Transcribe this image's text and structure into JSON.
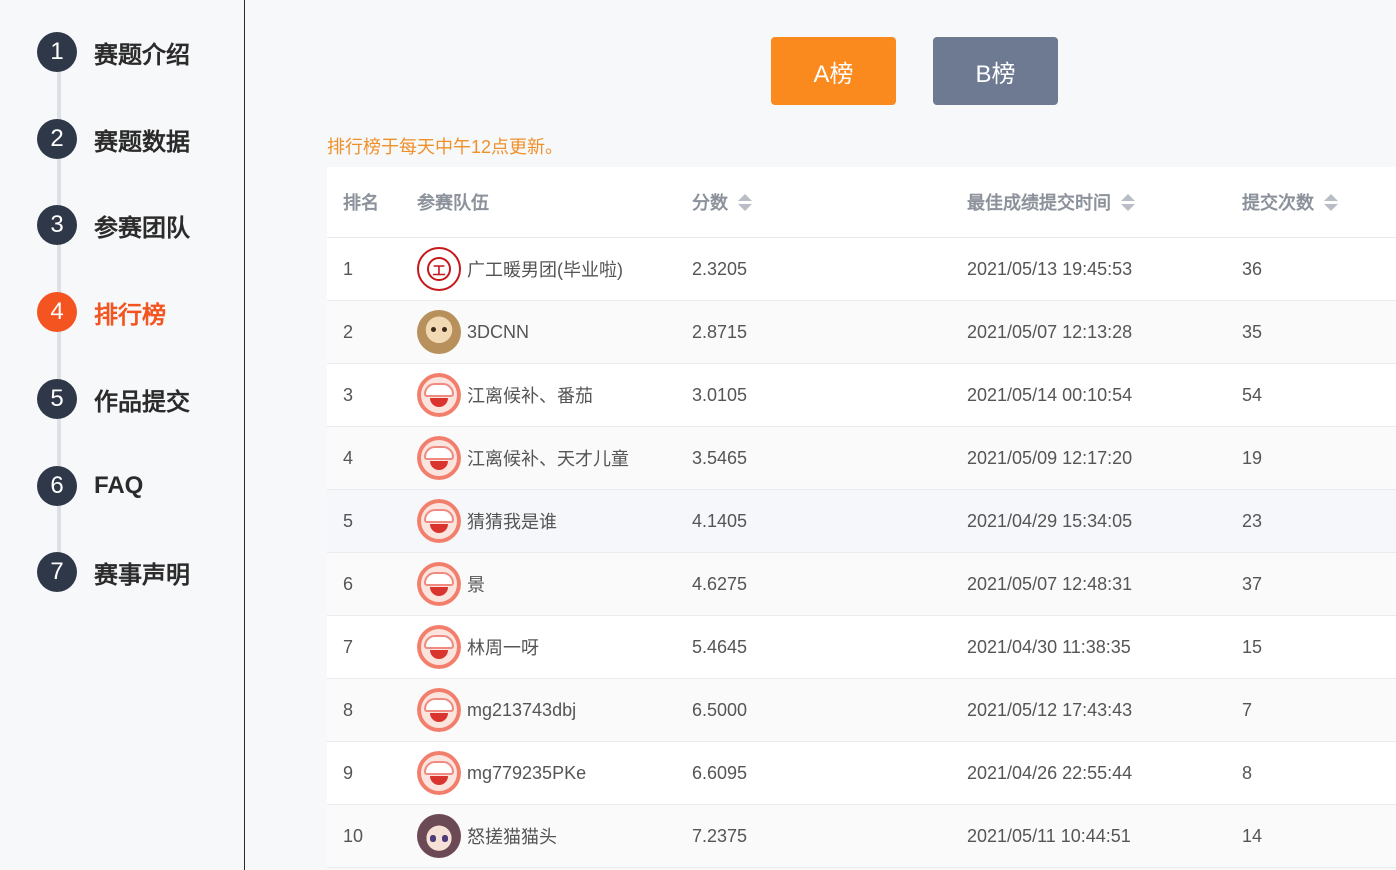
{
  "sidebar": {
    "steps": [
      {
        "num": "1",
        "label": "赛题介绍"
      },
      {
        "num": "2",
        "label": "赛题数据"
      },
      {
        "num": "3",
        "label": "参赛团队"
      },
      {
        "num": "4",
        "label": "排行榜",
        "active": true
      },
      {
        "num": "5",
        "label": "作品提交"
      },
      {
        "num": "6",
        "label": "FAQ"
      },
      {
        "num": "7",
        "label": "赛事声明"
      }
    ]
  },
  "board": {
    "a_label": "A榜",
    "b_label": "B榜",
    "a_color": "#fa891e",
    "b_color": "#6d7a92",
    "notice": "排行榜于每天中午12点更新。"
  },
  "table": {
    "headers": {
      "rank": "排名",
      "team": "参赛队伍",
      "score": "分数",
      "time": "最佳成绩提交时间",
      "count": "提交次数"
    },
    "rows": [
      {
        "rank": "1",
        "avatar": "school-logo-icon",
        "team": "广工暖男团(毕业啦)",
        "score": "2.3205",
        "time": "2021/05/13 19:45:53",
        "count": "36"
      },
      {
        "rank": "2",
        "avatar": "cat-avatar-icon",
        "team": "3DCNN",
        "score": "2.8715",
        "time": "2021/05/07 12:13:28",
        "count": "35"
      },
      {
        "rank": "3",
        "avatar": "default-avatar-icon",
        "team": "江离候补、番茄",
        "score": "3.0105",
        "time": "2021/05/14 00:10:54",
        "count": "54"
      },
      {
        "rank": "4",
        "avatar": "default-avatar-icon",
        "team": "江离候补、天才儿童",
        "score": "3.5465",
        "time": "2021/05/09 12:17:20",
        "count": "19"
      },
      {
        "rank": "5",
        "avatar": "default-avatar-icon",
        "team": "猜猜我是谁",
        "score": "4.1405",
        "time": "2021/04/29 15:34:05",
        "count": "23"
      },
      {
        "rank": "6",
        "avatar": "default-avatar-icon",
        "team": "景",
        "score": "4.6275",
        "time": "2021/05/07 12:48:31",
        "count": "37"
      },
      {
        "rank": "7",
        "avatar": "default-avatar-icon",
        "team": "林周一呀",
        "score": "5.4645",
        "time": "2021/04/30 11:38:35",
        "count": "15"
      },
      {
        "rank": "8",
        "avatar": "default-avatar-icon",
        "team": "mg213743dbj",
        "score": "6.5000",
        "time": "2021/05/12 17:43:43",
        "count": "7"
      },
      {
        "rank": "9",
        "avatar": "default-avatar-icon",
        "team": "mg779235PKe",
        "score": "6.6095",
        "time": "2021/04/26 22:55:44",
        "count": "8"
      },
      {
        "rank": "10",
        "avatar": "anime-avatar-icon",
        "team": "怒搓猫猫头",
        "score": "7.2375",
        "time": "2021/05/11 10:44:51",
        "count": "14"
      }
    ]
  },
  "colors": {
    "accent": "#f4541f",
    "step_default": "#2f3849",
    "notice": "#f0902a"
  }
}
